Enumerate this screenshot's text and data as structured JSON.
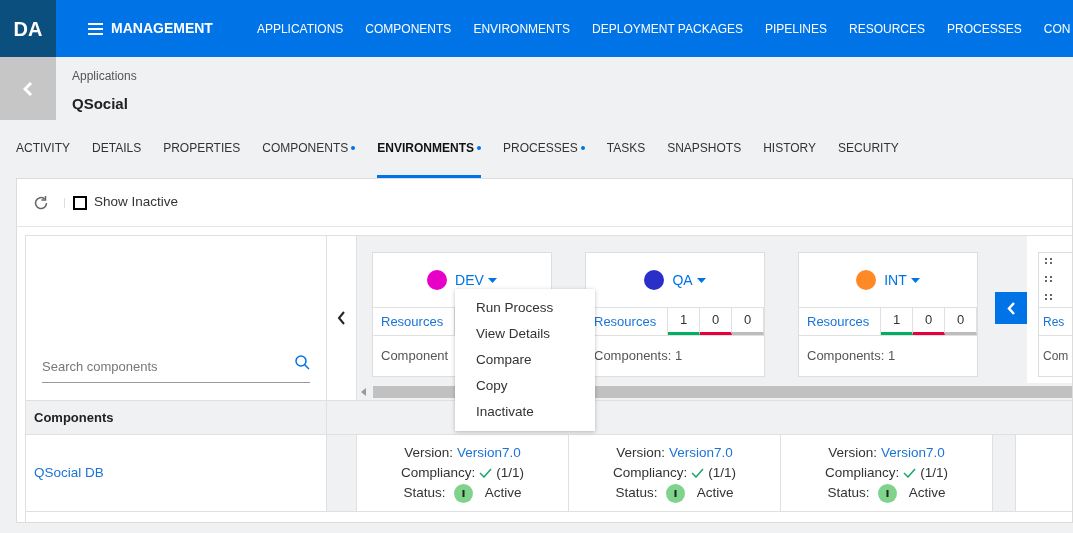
{
  "logo": "DA",
  "menu_title": "MANAGEMENT",
  "nav": [
    "APPLICATIONS",
    "COMPONENTS",
    "ENVIRONMENTS",
    "DEPLOYMENT PACKAGES",
    "PIPELINES",
    "RESOURCES",
    "PROCESSES",
    "CON"
  ],
  "breadcrumb": "Applications",
  "page_title": "QSocial",
  "tabs": [
    {
      "label": "ACTIVITY",
      "dot": false,
      "selected": false
    },
    {
      "label": "DETAILS",
      "dot": false,
      "selected": false
    },
    {
      "label": "PROPERTIES",
      "dot": false,
      "selected": false
    },
    {
      "label": "COMPONENTS",
      "dot": true,
      "selected": false
    },
    {
      "label": "ENVIRONMENTS",
      "dot": true,
      "selected": true
    },
    {
      "label": "PROCESSES",
      "dot": true,
      "selected": false
    },
    {
      "label": "TASKS",
      "dot": false,
      "selected": false
    },
    {
      "label": "SNAPSHOTS",
      "dot": false,
      "selected": false
    },
    {
      "label": "HISTORY",
      "dot": false,
      "selected": false
    },
    {
      "label": "SECURITY",
      "dot": false,
      "selected": false
    }
  ],
  "show_inactive": {
    "label": "Show Inactive",
    "checked": false
  },
  "search": {
    "placeholder": "Search components"
  },
  "environments": [
    {
      "kind": "card",
      "name": "DEV",
      "color": "#e800c8",
      "resources": "Resources",
      "components": "Component",
      "menu_open": true
    },
    {
      "kind": "card",
      "name": "QA",
      "color": "#2a2fc8",
      "resources": "Resources",
      "counts": [
        {
          "value": "1",
          "color": "#00b060"
        },
        {
          "value": "0",
          "color": "#e8003c"
        },
        {
          "value": "0",
          "color": "#bdbdbd"
        }
      ],
      "components": "Components: 1",
      "menu_open": false
    },
    {
      "kind": "card",
      "name": "INT",
      "color": "#ff8a25",
      "resources": "Resources",
      "counts": [
        {
          "value": "1",
          "color": "#00b060"
        },
        {
          "value": "0",
          "color": "#e8003c"
        },
        {
          "value": "0",
          "color": "#bdbdbd"
        }
      ],
      "components": "Components: 1",
      "menu_open": false
    },
    {
      "kind": "partial",
      "resources": "Res",
      "components": "Com"
    }
  ],
  "env_menu": [
    "Run Process",
    "View Details",
    "Compare",
    "Copy",
    "Inactivate"
  ],
  "components_header": "Components",
  "rows": [
    {
      "name": "QSocial DB",
      "cells": [
        {
          "version_label": "Version:",
          "version": "Version7.0",
          "compliancy_label": "Compliancy:",
          "compliancy": "(1/1)",
          "status_label": "Status:",
          "status": "Active"
        },
        {
          "version_label": "Version:",
          "version": "Version7.0",
          "compliancy_label": "Compliancy:",
          "compliancy": "(1/1)",
          "status_label": "Status:",
          "status": "Active"
        },
        {
          "version_label": "Version:",
          "version": "Version7.0",
          "compliancy_label": "Compliancy:",
          "compliancy": "(1/1)",
          "status_label": "Status:",
          "status": "Active"
        }
      ]
    }
  ]
}
